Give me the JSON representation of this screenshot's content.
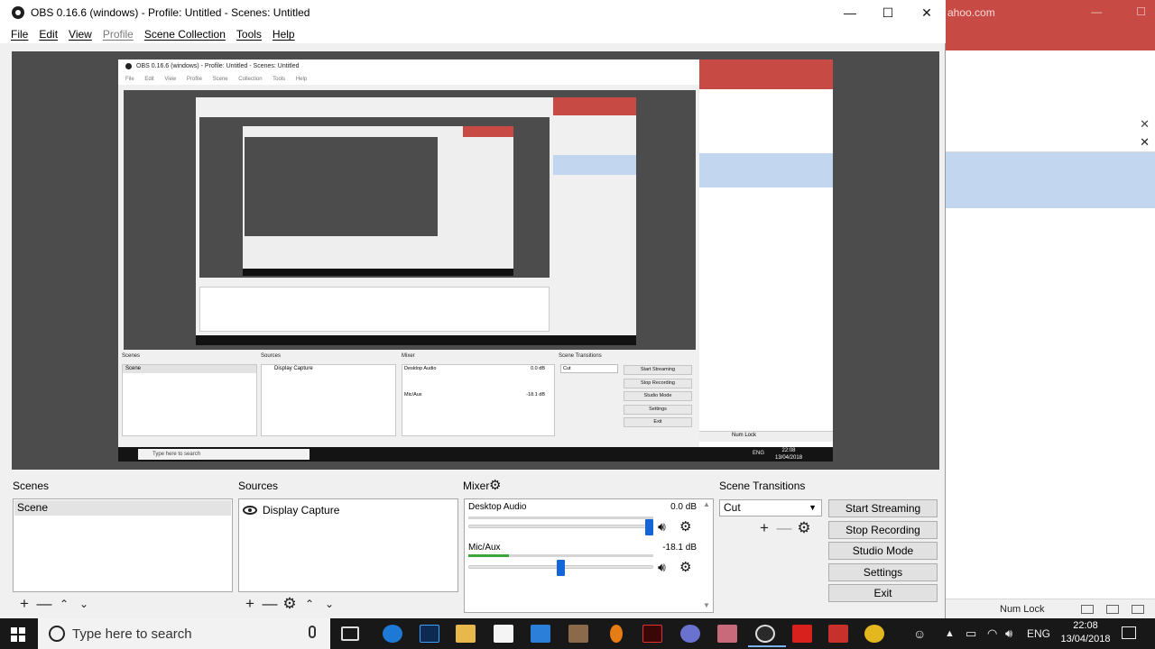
{
  "window": {
    "title": "OBS 0.16.6 (windows) - Profile: Untitled - Scenes: Untitled",
    "minimize": "—",
    "maximize": "☐",
    "close": "✕"
  },
  "menu": [
    {
      "label": "File"
    },
    {
      "label": "Edit"
    },
    {
      "label": "View"
    },
    {
      "label": "Profile",
      "disabled": true
    },
    {
      "label": "Scene Collection"
    },
    {
      "label": "Tools"
    },
    {
      "label": "Help"
    }
  ],
  "background_window": {
    "url_fragment": "ahoo.com",
    "status_numlock": "Num Lock"
  },
  "preview_nested": {
    "title": "OBS 0.16.6 (windows) - Profile: Untitled - Scenes: Untitled",
    "menu": "File Edit View Profile Scene Collection Tools Help",
    "docks": {
      "scenes": "Scenes",
      "sources": "Sources",
      "mixer": "Mixer",
      "transitions": "Scene Transitions",
      "scene": "Scene",
      "source": "Display Capture",
      "desktop_audio": "Desktop Audio",
      "desktop_db": "0.0 dB",
      "mic": "Mic/Aux",
      "mic_db": "-18.1 dB",
      "cut": "Cut",
      "buttons": [
        "Start Streaming",
        "Stop Recording",
        "Studio Mode",
        "Settings",
        "Exit"
      ]
    },
    "taskbar_search": "Type here to search",
    "time": "22:08",
    "date": "13/04/2018",
    "lang": "ENG",
    "numlock": "Num Lock"
  },
  "docks": {
    "scenes": {
      "title": "Scenes",
      "items": [
        "Scene"
      ]
    },
    "sources": {
      "title": "Sources",
      "items": [
        "Display Capture"
      ]
    },
    "mixer": {
      "title": "Mixer",
      "channels": [
        {
          "name": "Desktop Audio",
          "db": "0.0 dB",
          "level": 0,
          "volume": 1.0
        },
        {
          "name": "Mic/Aux",
          "db": "-18.1 dB",
          "level": 0.22,
          "volume": 0.5
        }
      ]
    },
    "transitions": {
      "title": "Scene Transitions",
      "selected": "Cut"
    }
  },
  "controls": [
    "Start Streaming",
    "Stop Recording",
    "Studio Mode",
    "Settings",
    "Exit"
  ],
  "taskbar": {
    "search_placeholder": "Type here to search",
    "language": "ENG",
    "time": "22:08",
    "date": "13/04/2018"
  }
}
